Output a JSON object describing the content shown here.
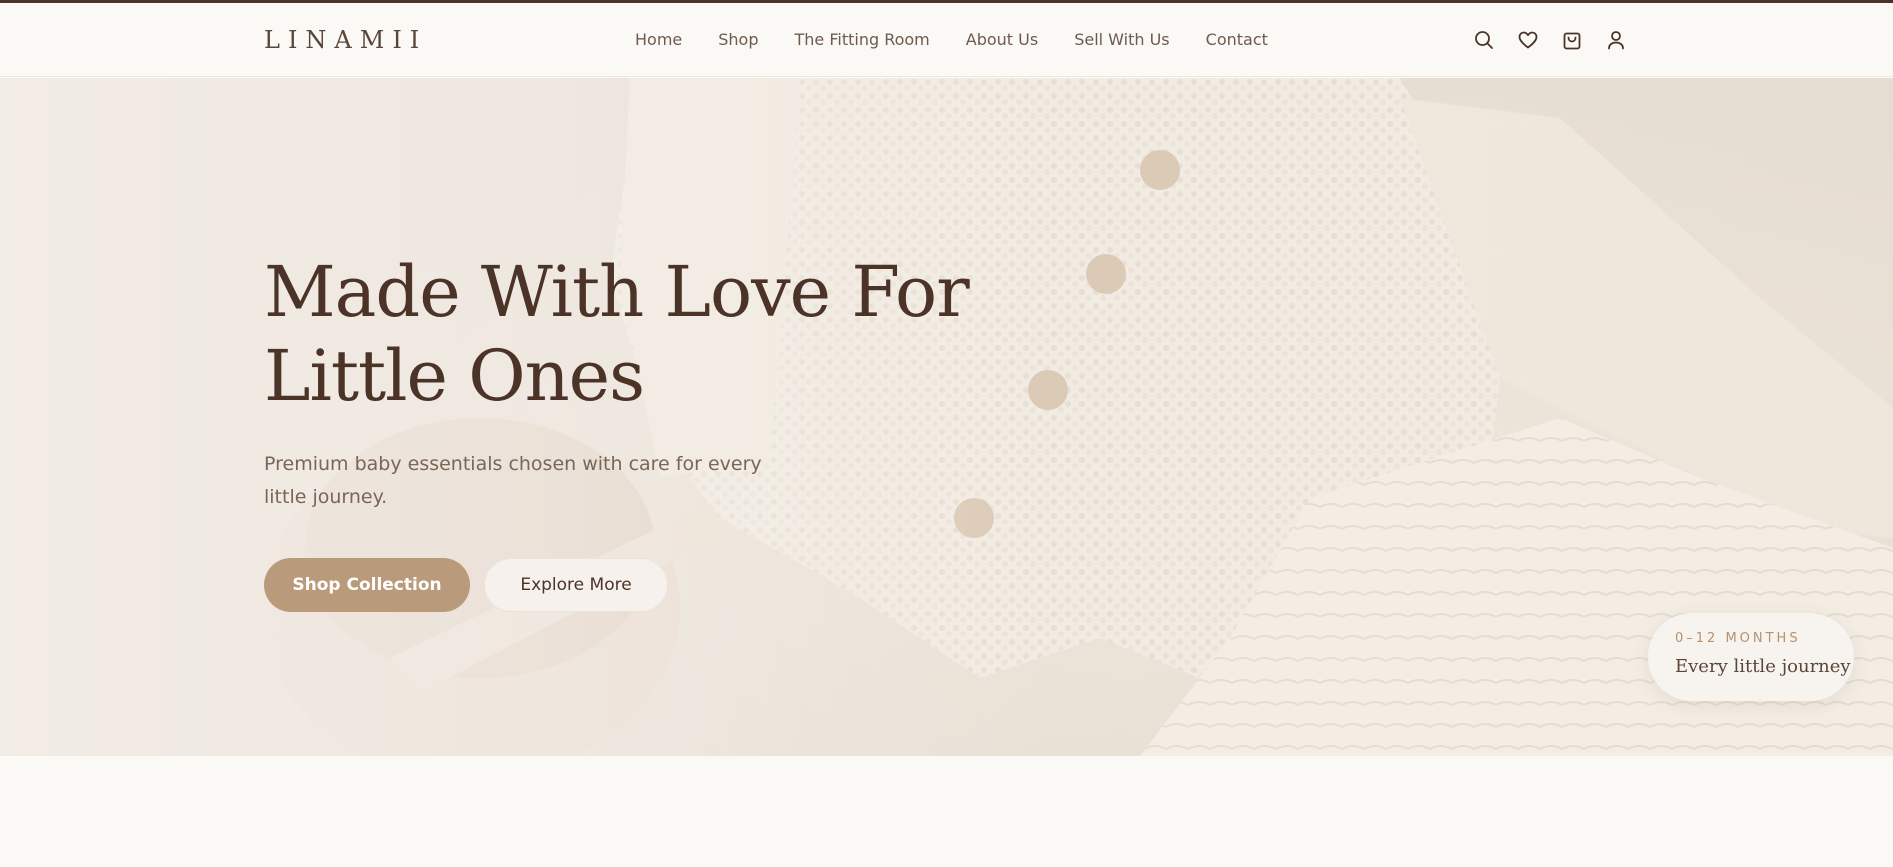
{
  "brand": {
    "logo_text": "LINAMII"
  },
  "nav": {
    "items": [
      "Home",
      "Shop",
      "The Fitting Room",
      "About Us",
      "Sell With Us",
      "Contact"
    ]
  },
  "header_icons": [
    "search-icon",
    "heart-icon",
    "cart-icon",
    "user-icon"
  ],
  "hero": {
    "title_line1": "Made With Love For",
    "title_line2": "Little Ones",
    "subtitle_line1": "Premium baby essentials chosen with care for every",
    "subtitle_line2": "little journey.",
    "primary_cta": "Shop Collection",
    "secondary_cta": "Explore More",
    "badge": {
      "eyebrow": "0–12 MONTHS",
      "text": "Every little journey"
    }
  },
  "colors": {
    "accent": "#b99b7b",
    "heading": "#4b3427",
    "body_text": "#7a6658",
    "background": "#faf9f6",
    "top_rule": "#4a3428"
  }
}
